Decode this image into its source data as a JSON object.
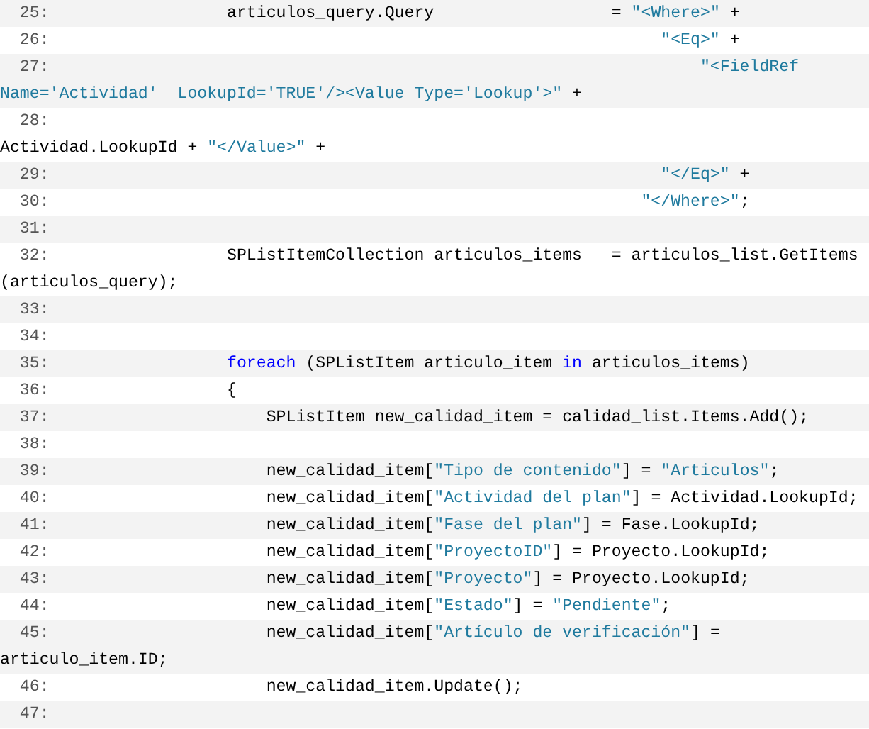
{
  "code_listing": {
    "lines": [
      {
        "number": "25:",
        "tokens": [
          {
            "kind": "plain",
            "text": "                  articulos_query.Query                  = "
          },
          {
            "kind": "string",
            "text": "\"<Where>\""
          },
          {
            "kind": "plain",
            "text": " +"
          }
        ]
      },
      {
        "number": "26:",
        "tokens": [
          {
            "kind": "string",
            "text": "                                                              \"<Eq>\""
          },
          {
            "kind": "plain",
            "text": " +"
          }
        ]
      },
      {
        "number": "27:",
        "tokens": [
          {
            "kind": "string",
            "text": "                                                                  \"<FieldRef Name='Actividad'  LookupId='TRUE'/><Value Type='Lookup'>\""
          },
          {
            "kind": "plain",
            "text": " +"
          }
        ]
      },
      {
        "number": "28:",
        "tokens": [
          {
            "kind": "plain",
            "text": "                                                                      Actividad.LookupId + "
          },
          {
            "kind": "string",
            "text": "\"</Value>\""
          },
          {
            "kind": "plain",
            "text": " +"
          }
        ]
      },
      {
        "number": "29:",
        "tokens": [
          {
            "kind": "string",
            "text": "                                                              \"</Eq>\""
          },
          {
            "kind": "plain",
            "text": " +"
          }
        ]
      },
      {
        "number": "30:",
        "tokens": [
          {
            "kind": "string",
            "text": "                                                            \"</Where>\""
          },
          {
            "kind": "plain",
            "text": ";"
          }
        ]
      },
      {
        "number": "31:"
      },
      {
        "number": "32:",
        "tokens": [
          {
            "kind": "plain",
            "text": "                  SPListItemCollection articulos_items   = articulos_list.GetItems (articulos_query);"
          }
        ]
      },
      {
        "number": "33:"
      },
      {
        "number": "34:"
      },
      {
        "number": "35:",
        "tokens": [
          {
            "kind": "keyword",
            "text": "                  foreach"
          },
          {
            "kind": "plain",
            "text": " (SPListItem articulo_item "
          },
          {
            "kind": "keyword",
            "text": "in"
          },
          {
            "kind": "plain",
            "text": " articulos_items)"
          }
        ]
      },
      {
        "number": "36:",
        "tokens": [
          {
            "kind": "plain",
            "text": "                  {"
          }
        ]
      },
      {
        "number": "37:",
        "tokens": [
          {
            "kind": "plain",
            "text": "                      SPListItem new_calidad_item = calidad_list.Items.Add();"
          }
        ]
      },
      {
        "number": "38:"
      },
      {
        "number": "39:",
        "tokens": [
          {
            "kind": "plain",
            "text": "                      new_calidad_item["
          },
          {
            "kind": "string",
            "text": "\"Tipo de contenido\""
          },
          {
            "kind": "plain",
            "text": "] = "
          },
          {
            "kind": "string",
            "text": "\"Articulos\""
          },
          {
            "kind": "plain",
            "text": ";"
          }
        ]
      },
      {
        "number": "40:",
        "tokens": [
          {
            "kind": "plain",
            "text": "                      new_calidad_item["
          },
          {
            "kind": "string",
            "text": "\"Actividad del plan\""
          },
          {
            "kind": "plain",
            "text": "] = Actividad.LookupId;"
          }
        ]
      },
      {
        "number": "41:",
        "tokens": [
          {
            "kind": "plain",
            "text": "                      new_calidad_item["
          },
          {
            "kind": "string",
            "text": "\"Fase del plan\""
          },
          {
            "kind": "plain",
            "text": "] = Fase.LookupId;"
          }
        ]
      },
      {
        "number": "42:",
        "tokens": [
          {
            "kind": "plain",
            "text": "                      new_calidad_item["
          },
          {
            "kind": "string",
            "text": "\"ProyectoID\""
          },
          {
            "kind": "plain",
            "text": "] = Proyecto.LookupId;"
          }
        ]
      },
      {
        "number": "43:",
        "tokens": [
          {
            "kind": "plain",
            "text": "                      new_calidad_item["
          },
          {
            "kind": "string",
            "text": "\"Proyecto\""
          },
          {
            "kind": "plain",
            "text": "] = Proyecto.LookupId;"
          }
        ]
      },
      {
        "number": "44:",
        "tokens": [
          {
            "kind": "plain",
            "text": "                      new_calidad_item["
          },
          {
            "kind": "string",
            "text": "\"Estado\""
          },
          {
            "kind": "plain",
            "text": "] = "
          },
          {
            "kind": "string",
            "text": "\"Pendiente\""
          },
          {
            "kind": "plain",
            "text": ";"
          }
        ]
      },
      {
        "number": "45:",
        "tokens": [
          {
            "kind": "plain",
            "text": "                      new_calidad_item["
          },
          {
            "kind": "string",
            "text": "\"Artículo de verificación\""
          },
          {
            "kind": "plain",
            "text": "] = articulo_item.ID;"
          }
        ]
      },
      {
        "number": "46:",
        "tokens": [
          {
            "kind": "plain",
            "text": "                      new_calidad_item.Update();"
          }
        ]
      },
      {
        "number": "47:"
      }
    ]
  }
}
